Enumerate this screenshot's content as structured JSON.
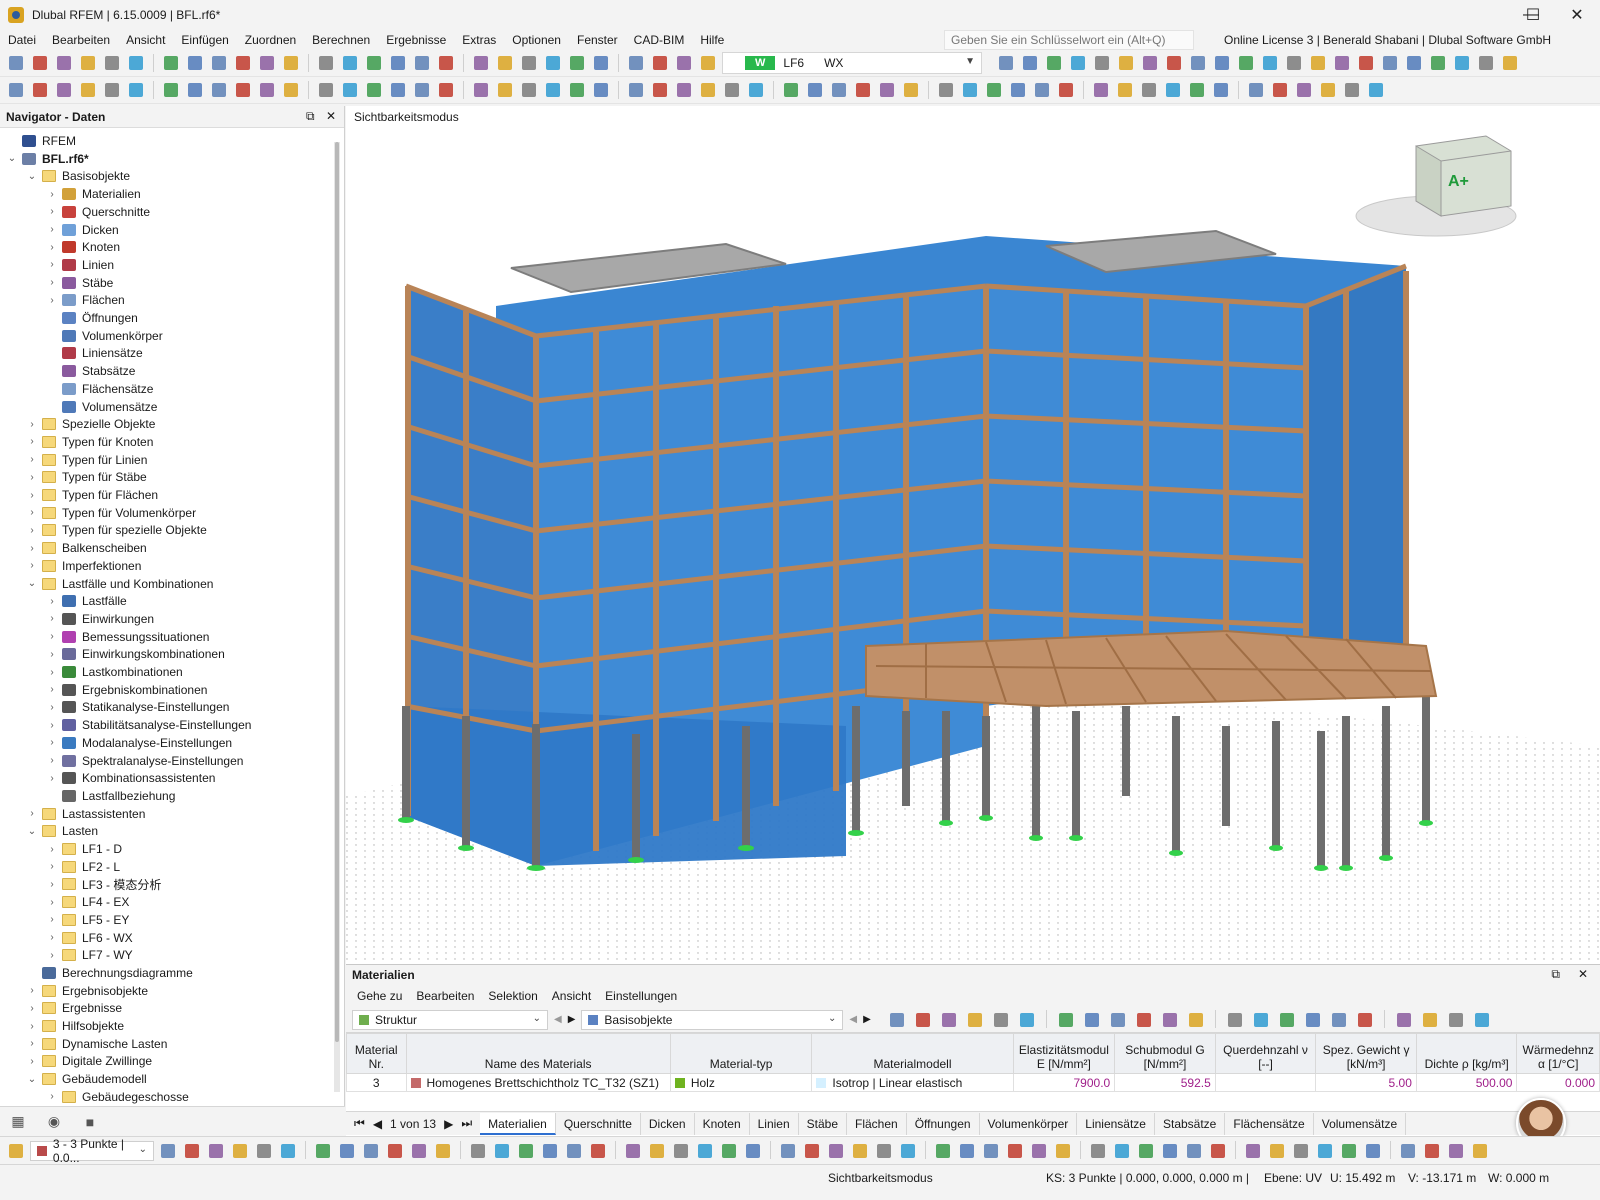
{
  "window": {
    "title": "Dlubal RFEM | 6.15.0009 | BFL.rf6*",
    "minimize_glyph": "—",
    "maximize_glyph": "☐",
    "close_glyph": "✕"
  },
  "menu": {
    "items": [
      "Datei",
      "Bearbeiten",
      "Ansicht",
      "Einfügen",
      "Zuordnen",
      "Berechnen",
      "Ergebnisse",
      "Extras",
      "Optionen",
      "Fenster",
      "CAD-BIM",
      "Hilfe"
    ],
    "search_placeholder": "Geben Sie ein Schlüsselwort ein (Alt+Q)",
    "license": "Online License 3 | Benerald Shabani | Dlubal Software GmbH"
  },
  "load_case_selector": {
    "badge": "W",
    "number": "LF6",
    "name": "WX"
  },
  "navigator": {
    "title": "Navigator - Daten",
    "items": [
      {
        "label": "RFEM",
        "level": 0,
        "chev": "",
        "icon": "obj",
        "color": "#2f4f8f"
      },
      {
        "label": "BFL.rf6*",
        "level": 0,
        "chev": "⌄",
        "icon": "obj",
        "color": "#6c7fa6",
        "bold": true
      },
      {
        "label": "Basisobjekte",
        "level": 1,
        "chev": "⌄",
        "icon": "folder"
      },
      {
        "label": "Materialien",
        "level": 2,
        "chev": "›",
        "icon": "obj",
        "color": "#d2a13a"
      },
      {
        "label": "Querschnitte",
        "level": 2,
        "chev": "›",
        "icon": "obj",
        "color": "#c8423c"
      },
      {
        "label": "Dicken",
        "level": 2,
        "chev": "›",
        "icon": "obj",
        "color": "#6fa0d8"
      },
      {
        "label": "Knoten",
        "level": 2,
        "chev": "›",
        "icon": "obj",
        "color": "#c0392b"
      },
      {
        "label": "Linien",
        "level": 2,
        "chev": "›",
        "icon": "obj",
        "color": "#b03a48"
      },
      {
        "label": "Stäbe",
        "level": 2,
        "chev": "›",
        "icon": "obj",
        "color": "#8a5a9e"
      },
      {
        "label": "Flächen",
        "level": 2,
        "chev": "›",
        "icon": "obj",
        "color": "#7b9cc9"
      },
      {
        "label": "Öffnungen",
        "level": 2,
        "chev": "",
        "icon": "obj",
        "color": "#5b82c2"
      },
      {
        "label": "Volumenkörper",
        "level": 2,
        "chev": "",
        "icon": "obj",
        "color": "#4f79b8"
      },
      {
        "label": "Liniensätze",
        "level": 2,
        "chev": "",
        "icon": "obj",
        "color": "#b03a48"
      },
      {
        "label": "Stabsätze",
        "level": 2,
        "chev": "",
        "icon": "obj",
        "color": "#8a5a9e"
      },
      {
        "label": "Flächensätze",
        "level": 2,
        "chev": "",
        "icon": "obj",
        "color": "#7b9cc9"
      },
      {
        "label": "Volumensätze",
        "level": 2,
        "chev": "",
        "icon": "obj",
        "color": "#4f79b8"
      },
      {
        "label": "Spezielle Objekte",
        "level": 1,
        "chev": "›",
        "icon": "folder"
      },
      {
        "label": "Typen für Knoten",
        "level": 1,
        "chev": "›",
        "icon": "folder"
      },
      {
        "label": "Typen für Linien",
        "level": 1,
        "chev": "›",
        "icon": "folder"
      },
      {
        "label": "Typen für Stäbe",
        "level": 1,
        "chev": "›",
        "icon": "folder"
      },
      {
        "label": "Typen für Flächen",
        "level": 1,
        "chev": "›",
        "icon": "folder"
      },
      {
        "label": "Typen für Volumenkörper",
        "level": 1,
        "chev": "›",
        "icon": "folder"
      },
      {
        "label": "Typen für spezielle Objekte",
        "level": 1,
        "chev": "›",
        "icon": "folder"
      },
      {
        "label": "Balkenscheiben",
        "level": 1,
        "chev": "›",
        "icon": "folder"
      },
      {
        "label": "Imperfektionen",
        "level": 1,
        "chev": "›",
        "icon": "folder"
      },
      {
        "label": "Lastfälle und Kombinationen",
        "level": 1,
        "chev": "⌄",
        "icon": "folder"
      },
      {
        "label": "Lastfälle",
        "level": 2,
        "chev": "›",
        "icon": "obj",
        "color": "#3f6fb0"
      },
      {
        "label": "Einwirkungen",
        "level": 2,
        "chev": "›",
        "icon": "obj",
        "color": "#555"
      },
      {
        "label": "Bemessungssituationen",
        "level": 2,
        "chev": "›",
        "icon": "obj",
        "color": "#b040b0"
      },
      {
        "label": "Einwirkungskombinationen",
        "level": 2,
        "chev": "›",
        "icon": "obj",
        "color": "#6a6a9a"
      },
      {
        "label": "Lastkombinationen",
        "level": 2,
        "chev": "›",
        "icon": "obj",
        "color": "#3a8a3a"
      },
      {
        "label": "Ergebniskombinationen",
        "level": 2,
        "chev": "›",
        "icon": "obj",
        "color": "#555"
      },
      {
        "label": "Statikanalyse-Einstellungen",
        "level": 2,
        "chev": "›",
        "icon": "obj",
        "color": "#555"
      },
      {
        "label": "Stabilitätsanalyse-Einstellungen",
        "level": 2,
        "chev": "›",
        "icon": "obj",
        "color": "#6060a0"
      },
      {
        "label": "Modalanalyse-Einstellungen",
        "level": 2,
        "chev": "›",
        "icon": "obj",
        "color": "#3a7ac0"
      },
      {
        "label": "Spektralanalyse-Einstellungen",
        "level": 2,
        "chev": "›",
        "icon": "obj",
        "color": "#7070a0"
      },
      {
        "label": "Kombinationsassistenten",
        "level": 2,
        "chev": "›",
        "icon": "obj",
        "color": "#555"
      },
      {
        "label": "Lastfallbeziehung",
        "level": 2,
        "chev": "",
        "icon": "obj",
        "color": "#666"
      },
      {
        "label": "Lastassistenten",
        "level": 1,
        "chev": "›",
        "icon": "folder"
      },
      {
        "label": "Lasten",
        "level": 1,
        "chev": "⌄",
        "icon": "folder"
      },
      {
        "label": "LF1 - D",
        "level": 2,
        "chev": "›",
        "icon": "folder"
      },
      {
        "label": "LF2 - L",
        "level": 2,
        "chev": "›",
        "icon": "folder"
      },
      {
        "label": "LF3 - 模态分析",
        "level": 2,
        "chev": "›",
        "icon": "folder"
      },
      {
        "label": "LF4 - EX",
        "level": 2,
        "chev": "›",
        "icon": "folder"
      },
      {
        "label": "LF5 - EY",
        "level": 2,
        "chev": "›",
        "icon": "folder"
      },
      {
        "label": "LF6 - WX",
        "level": 2,
        "chev": "›",
        "icon": "folder"
      },
      {
        "label": "LF7 - WY",
        "level": 2,
        "chev": "›",
        "icon": "folder"
      },
      {
        "label": "Berechnungsdiagramme",
        "level": 1,
        "chev": "",
        "icon": "obj",
        "color": "#4a6a9a"
      },
      {
        "label": "Ergebnisobjekte",
        "level": 1,
        "chev": "›",
        "icon": "folder"
      },
      {
        "label": "Ergebnisse",
        "level": 1,
        "chev": "›",
        "icon": "folder"
      },
      {
        "label": "Hilfsobjekte",
        "level": 1,
        "chev": "›",
        "icon": "folder"
      },
      {
        "label": "Dynamische Lasten",
        "level": 1,
        "chev": "›",
        "icon": "folder"
      },
      {
        "label": "Digitale Zwillinge",
        "level": 1,
        "chev": "›",
        "icon": "folder"
      },
      {
        "label": "Gebäudemodell",
        "level": 1,
        "chev": "⌄",
        "icon": "folder"
      },
      {
        "label": "Gebäudegeschosse",
        "level": 2,
        "chev": "›",
        "icon": "folder"
      }
    ]
  },
  "viewport": {
    "mode_label": "Sichtbarkeitsmodus",
    "navcube_label": "A+"
  },
  "materials_panel": {
    "title": "Materialien",
    "menu": [
      "Gehe zu",
      "Bearbeiten",
      "Selektion",
      "Ansicht",
      "Einstellungen"
    ],
    "combo_structure": "Struktur",
    "combo_basis": "Basisobjekte",
    "columns": [
      "Material Nr.",
      "Name des Materials",
      "Material-typ",
      "Materialmodell",
      "Elastizitätsmodul E [N/mm²]",
      "Schubmodul G [N/mm²]",
      "Querdehnzahl ν [--]",
      "Spez. Gewicht γ [kN/m³]",
      "Dichte ρ [kg/m³]",
      "Wärmedehnz α [1/°C]"
    ],
    "rows": [
      {
        "nr": "3",
        "name": "Homogenes Brettschichtholz TC_T32 (SZ1)",
        "name_color": "#c46a6a",
        "type": "Holz",
        "type_color": "#6fb320",
        "model": "Isotrop | Linear elastisch",
        "model_color": "#d5f0ff",
        "e": "7900.0",
        "g": "592.5",
        "nu": "",
        "gamma": "5.00",
        "rho": "500.00",
        "alpha": "0.000"
      }
    ],
    "pager": "1 von 13",
    "tabs": [
      "Materialien",
      "Querschnitte",
      "Dicken",
      "Knoten",
      "Linien",
      "Stäbe",
      "Flächen",
      "Öffnungen",
      "Volumenkörper",
      "Liniensätze",
      "Stabsätze",
      "Flächensätze",
      "Volumensätze"
    ]
  },
  "bottom_toolbar": {
    "combo": "3 - 3 Punkte | 0.0..."
  },
  "status": {
    "mode": "Sichtbarkeitsmodus",
    "ks": "KS: 3 Punkte | 0.000, 0.000, 0.000 m |",
    "plane": "Ebene: UV",
    "u": "U: 15.492 m",
    "v": "V: -13.171 m",
    "w": "W: 0.000 m"
  }
}
